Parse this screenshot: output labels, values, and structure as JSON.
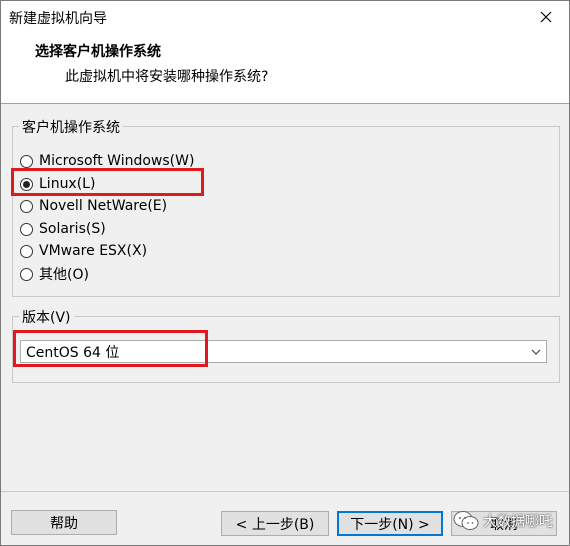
{
  "window": {
    "title": "新建虚拟机向导"
  },
  "header": {
    "title": "选择客户机操作系统",
    "subtitle": "此虚拟机中将安装哪种操作系统?"
  },
  "os_group": {
    "legend": "客户机操作系统",
    "options": [
      {
        "label": "Microsoft Windows(W)",
        "checked": false
      },
      {
        "label": "Linux(L)",
        "checked": true
      },
      {
        "label": "Novell NetWare(E)",
        "checked": false
      },
      {
        "label": "Solaris(S)",
        "checked": false
      },
      {
        "label": "VMware ESX(X)",
        "checked": false
      },
      {
        "label": "其他(O)",
        "checked": false
      }
    ]
  },
  "version_group": {
    "legend": "版本(V)",
    "selected": "CentOS 64 位"
  },
  "buttons": {
    "help": "帮助",
    "back": "< 上一步(B)",
    "next": "下一步(N) >",
    "cancel": "取消"
  },
  "watermark": {
    "text": "大数据哪吒"
  },
  "colors": {
    "highlight": "#e0191e",
    "default_button_border": "#0078d7"
  },
  "icons": [
    "close-icon",
    "chevron-down-icon",
    "wechat-icon"
  ]
}
